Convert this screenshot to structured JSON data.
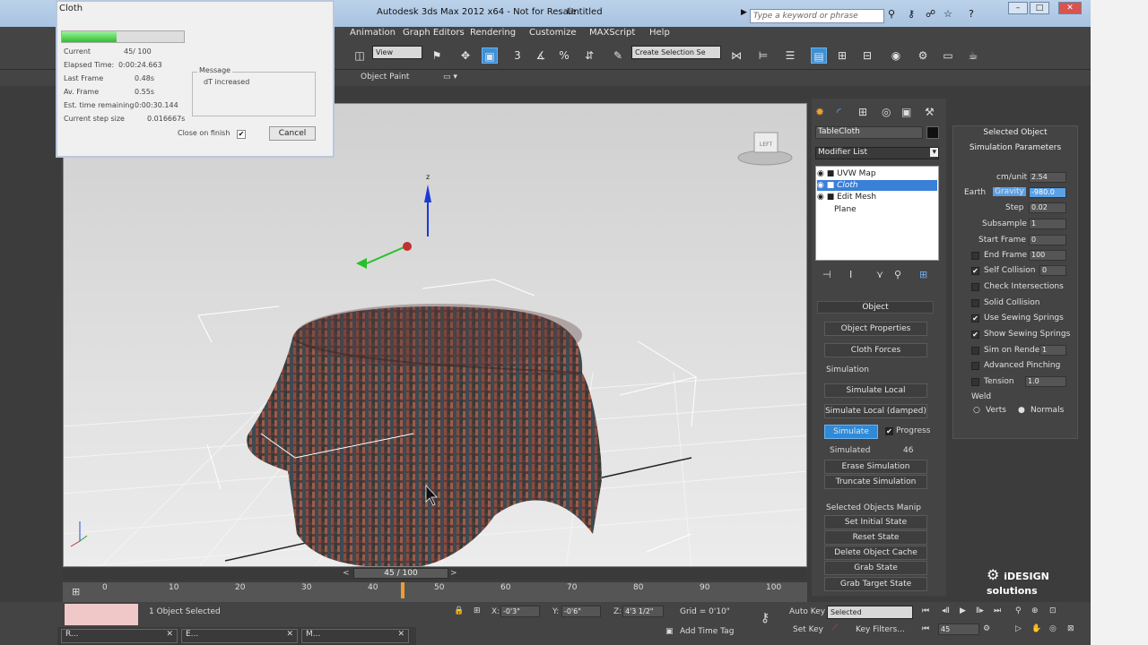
{
  "app": {
    "title": "Autodesk 3ds Max  2012 x64  - Not for Resale",
    "file": "Untitled",
    "search_placeholder": "Type a keyword or phrase"
  },
  "menu": [
    "Animation",
    "Graph Editors",
    "Rendering",
    "Customize",
    "MAXScript",
    "Help"
  ],
  "toolbar": {
    "view_combo": "View",
    "selection_set": "Create Selection Se",
    "ribbon_tab": "Object Paint"
  },
  "cloth_dialog": {
    "caption": "Cloth",
    "progress": 0.45,
    "rows": [
      {
        "label": "Current",
        "value": "45/  100"
      },
      {
        "label": "Elapsed Time:",
        "value": "0:00:24.663"
      },
      {
        "label": "Last Frame",
        "value": "0.48s"
      },
      {
        "label": "Av. Frame",
        "value": "0.55s"
      },
      {
        "label": "Est. time remaining",
        "value": "0:00:30.144"
      },
      {
        "label": "Current step size",
        "value": "0.016667s"
      }
    ],
    "message_label": "Message",
    "message": "dT increased",
    "close_on_finish": "Close on finish",
    "cancel": "Cancel"
  },
  "command_panel": {
    "object_name": "TableCloth",
    "modifier_list": "Modifier List",
    "stack": [
      "UVW Map",
      "Cloth",
      "Edit Mesh",
      "Plane"
    ],
    "object_rollout": "Object",
    "btn_object_properties": "Object Properties",
    "btn_cloth_forces": "Cloth Forces",
    "simulation_group": "Simulation",
    "btn_simulate_local": "Simulate Local",
    "btn_simulate_local_damped": "Simulate Local (damped)",
    "btn_simulate": "Simulate",
    "progress_label": "Progress",
    "simulated_label": "Simulated",
    "simulated_value": "46",
    "btn_erase": "Erase Simulation",
    "btn_truncate": "Truncate Simulation",
    "selected_group": "Selected Objects Manip",
    "btn_set_initial": "Set Initial State",
    "btn_reset": "Reset State",
    "btn_delete_cache": "Delete Object Cache",
    "btn_grab": "Grab State",
    "btn_grab_target": "Grab Target State"
  },
  "params": {
    "selected_object": "Selected Object",
    "sim_params": "Simulation Parameters",
    "cm_unit_label": "cm/unit",
    "cm_unit": "2.54",
    "earth": "Earth",
    "gravity": "Gravity",
    "gravity_value": "-980.0",
    "step_label": "Step",
    "step": "0.02",
    "subsample_label": "Subsample",
    "subsample": "1",
    "start_frame_label": "Start Frame",
    "start_frame": "0",
    "end_frame_label": "End Frame",
    "end_frame": "100",
    "self_collision_label": "Self Collision",
    "self_collision": "0",
    "check_intersections": "Check Intersections",
    "solid_collision": "Solid Collision",
    "use_sewing": "Use Sewing Springs",
    "show_sewing": "Show Sewing Springs",
    "sim_on_render_label": "Sim on Render",
    "sim_on_render": "1",
    "advanced_pinching": "Advanced Pinching",
    "tension_label": "Tension",
    "tension": "1.0",
    "weld": "Weld",
    "verts": "Verts",
    "normals": "Normals"
  },
  "timeline": {
    "slider": "45 / 100",
    "ticks": [
      "0",
      "10",
      "20",
      "30",
      "40",
      "50",
      "60",
      "70",
      "80",
      "90",
      "100"
    ],
    "current": 45
  },
  "status": {
    "selection": "1 Object Selected",
    "x_label": "X:",
    "x": "-0'3\"",
    "y_label": "Y:",
    "y": "-0'6\"",
    "z_label": "Z:",
    "z": "4'3 1/2\"",
    "grid": "Grid = 0'10\"",
    "auto_key": "Auto Key",
    "selected": "Selected",
    "set_key": "Set Key",
    "key_filters": "Key Filters...",
    "frame": "45",
    "add_time_tag": "Add Time Tag"
  },
  "taskbar": [
    "R...",
    "E...",
    "M..."
  ],
  "logo": "iDESIGN solutions",
  "viewcube_label": "LEFT",
  "axis": {
    "z": "z",
    "y": "y",
    "x": "x"
  }
}
